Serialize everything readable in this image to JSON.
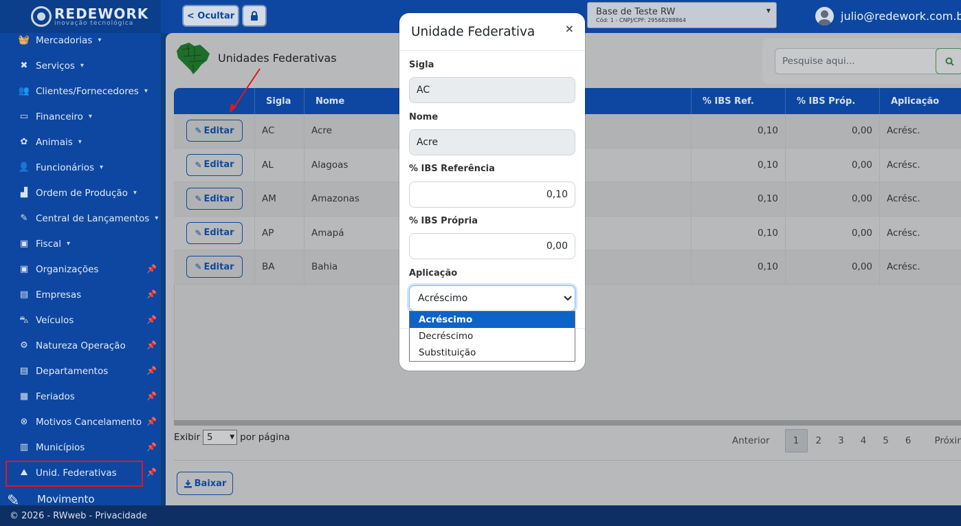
{
  "app": {
    "logo_name": "REDEWORK",
    "logo_sub": "inovação tecnológica",
    "hide_label": "< Ocultar",
    "lock_icon": "lock-icon",
    "base_name": "Base de Teste RW",
    "base_sub": "Cód: 1 - CNPJ/CPF: 29568288864",
    "user_email": "julio@redework.com.br"
  },
  "sidebar": {
    "items": [
      {
        "label": "Mercadorias",
        "icon": "basket-icon",
        "kind": "caret"
      },
      {
        "label": "Serviços",
        "icon": "tools-icon",
        "kind": "caret"
      },
      {
        "label": "Clientes/Fornecedores",
        "icon": "users-icon",
        "kind": "caret"
      },
      {
        "label": "Financeiro",
        "icon": "money-icon",
        "kind": "caret"
      },
      {
        "label": "Animais",
        "icon": "paw-icon",
        "kind": "caret"
      },
      {
        "label": "Funcionários",
        "icon": "user-tie-icon",
        "kind": "caret"
      },
      {
        "label": "Ordem de Produção",
        "icon": "factory-icon",
        "kind": "caret"
      },
      {
        "label": "Central de Lançamentos",
        "icon": "edit-icon",
        "kind": "caret"
      },
      {
        "label": "Fiscal",
        "icon": "briefcase-icon",
        "kind": "caret"
      },
      {
        "label": "Organizações",
        "icon": "briefcase-icon",
        "kind": "pin"
      },
      {
        "label": "Empresas",
        "icon": "building-icon",
        "kind": "pin"
      },
      {
        "label": "Veículos",
        "icon": "car-icon",
        "kind": "pin"
      },
      {
        "label": "Natureza Operação",
        "icon": "cogs-icon",
        "kind": "pin"
      },
      {
        "label": "Departamentos",
        "icon": "building-icon",
        "kind": "pin"
      },
      {
        "label": "Feriados",
        "icon": "calendar-icon",
        "kind": "pin"
      },
      {
        "label": "Motivos Cancelamento",
        "icon": "times-circle-icon",
        "kind": "pin"
      },
      {
        "label": "Municípios",
        "icon": "city-icon",
        "kind": "pin"
      },
      {
        "label": "Unid. Federativas",
        "icon": "map-icon",
        "kind": "pin"
      }
    ],
    "movimento": "Movimento"
  },
  "page": {
    "title": "Unidades Federativas",
    "search_placeholder": "Pesquise aqui..."
  },
  "table": {
    "headers": [
      "",
      "Sigla",
      "Nome",
      "% IBS Ref.",
      "% IBS Próp.",
      "Aplicação"
    ],
    "edit_label": "Editar",
    "rows": [
      {
        "sigla": "AC",
        "nome": "Acre",
        "ref": "0,10",
        "prop": "0,00",
        "apl": "Acrésc."
      },
      {
        "sigla": "AL",
        "nome": "Alagoas",
        "ref": "0,10",
        "prop": "0,00",
        "apl": "Acrésc."
      },
      {
        "sigla": "AM",
        "nome": "Amazonas",
        "ref": "0,10",
        "prop": "0,00",
        "apl": "Acrésc."
      },
      {
        "sigla": "AP",
        "nome": "Amapá",
        "ref": "0,10",
        "prop": "0,00",
        "apl": "Acrésc."
      },
      {
        "sigla": "BA",
        "nome": "Bahia",
        "ref": "0,10",
        "prop": "0,00",
        "apl": "Acrésc."
      }
    ]
  },
  "pagination": {
    "exibir": "Exibir",
    "per_page_value": "5",
    "per_page_suffix": "por página",
    "prev": "Anterior",
    "pages": [
      "1",
      "2",
      "3",
      "4",
      "5",
      "6"
    ],
    "next": "Próxim"
  },
  "baixar_label": "Baixar",
  "footer": "© 2026 - RWweb - Privacidade",
  "modal": {
    "title": "Unidade Federativa",
    "close": "×",
    "sigla_label": "Sigla",
    "sigla_value": "AC",
    "nome_label": "Nome",
    "nome_value": "Acre",
    "ibs_ref_label": "% IBS Referência",
    "ibs_ref_value": "0,10",
    "ibs_prop_label": "% IBS Própria",
    "ibs_prop_value": "0,00",
    "aplicacao_label": "Aplicação",
    "aplicacao_value": "Acréscimo",
    "options": [
      "Acréscimo",
      "Decréscimo",
      "Substituição"
    ]
  }
}
